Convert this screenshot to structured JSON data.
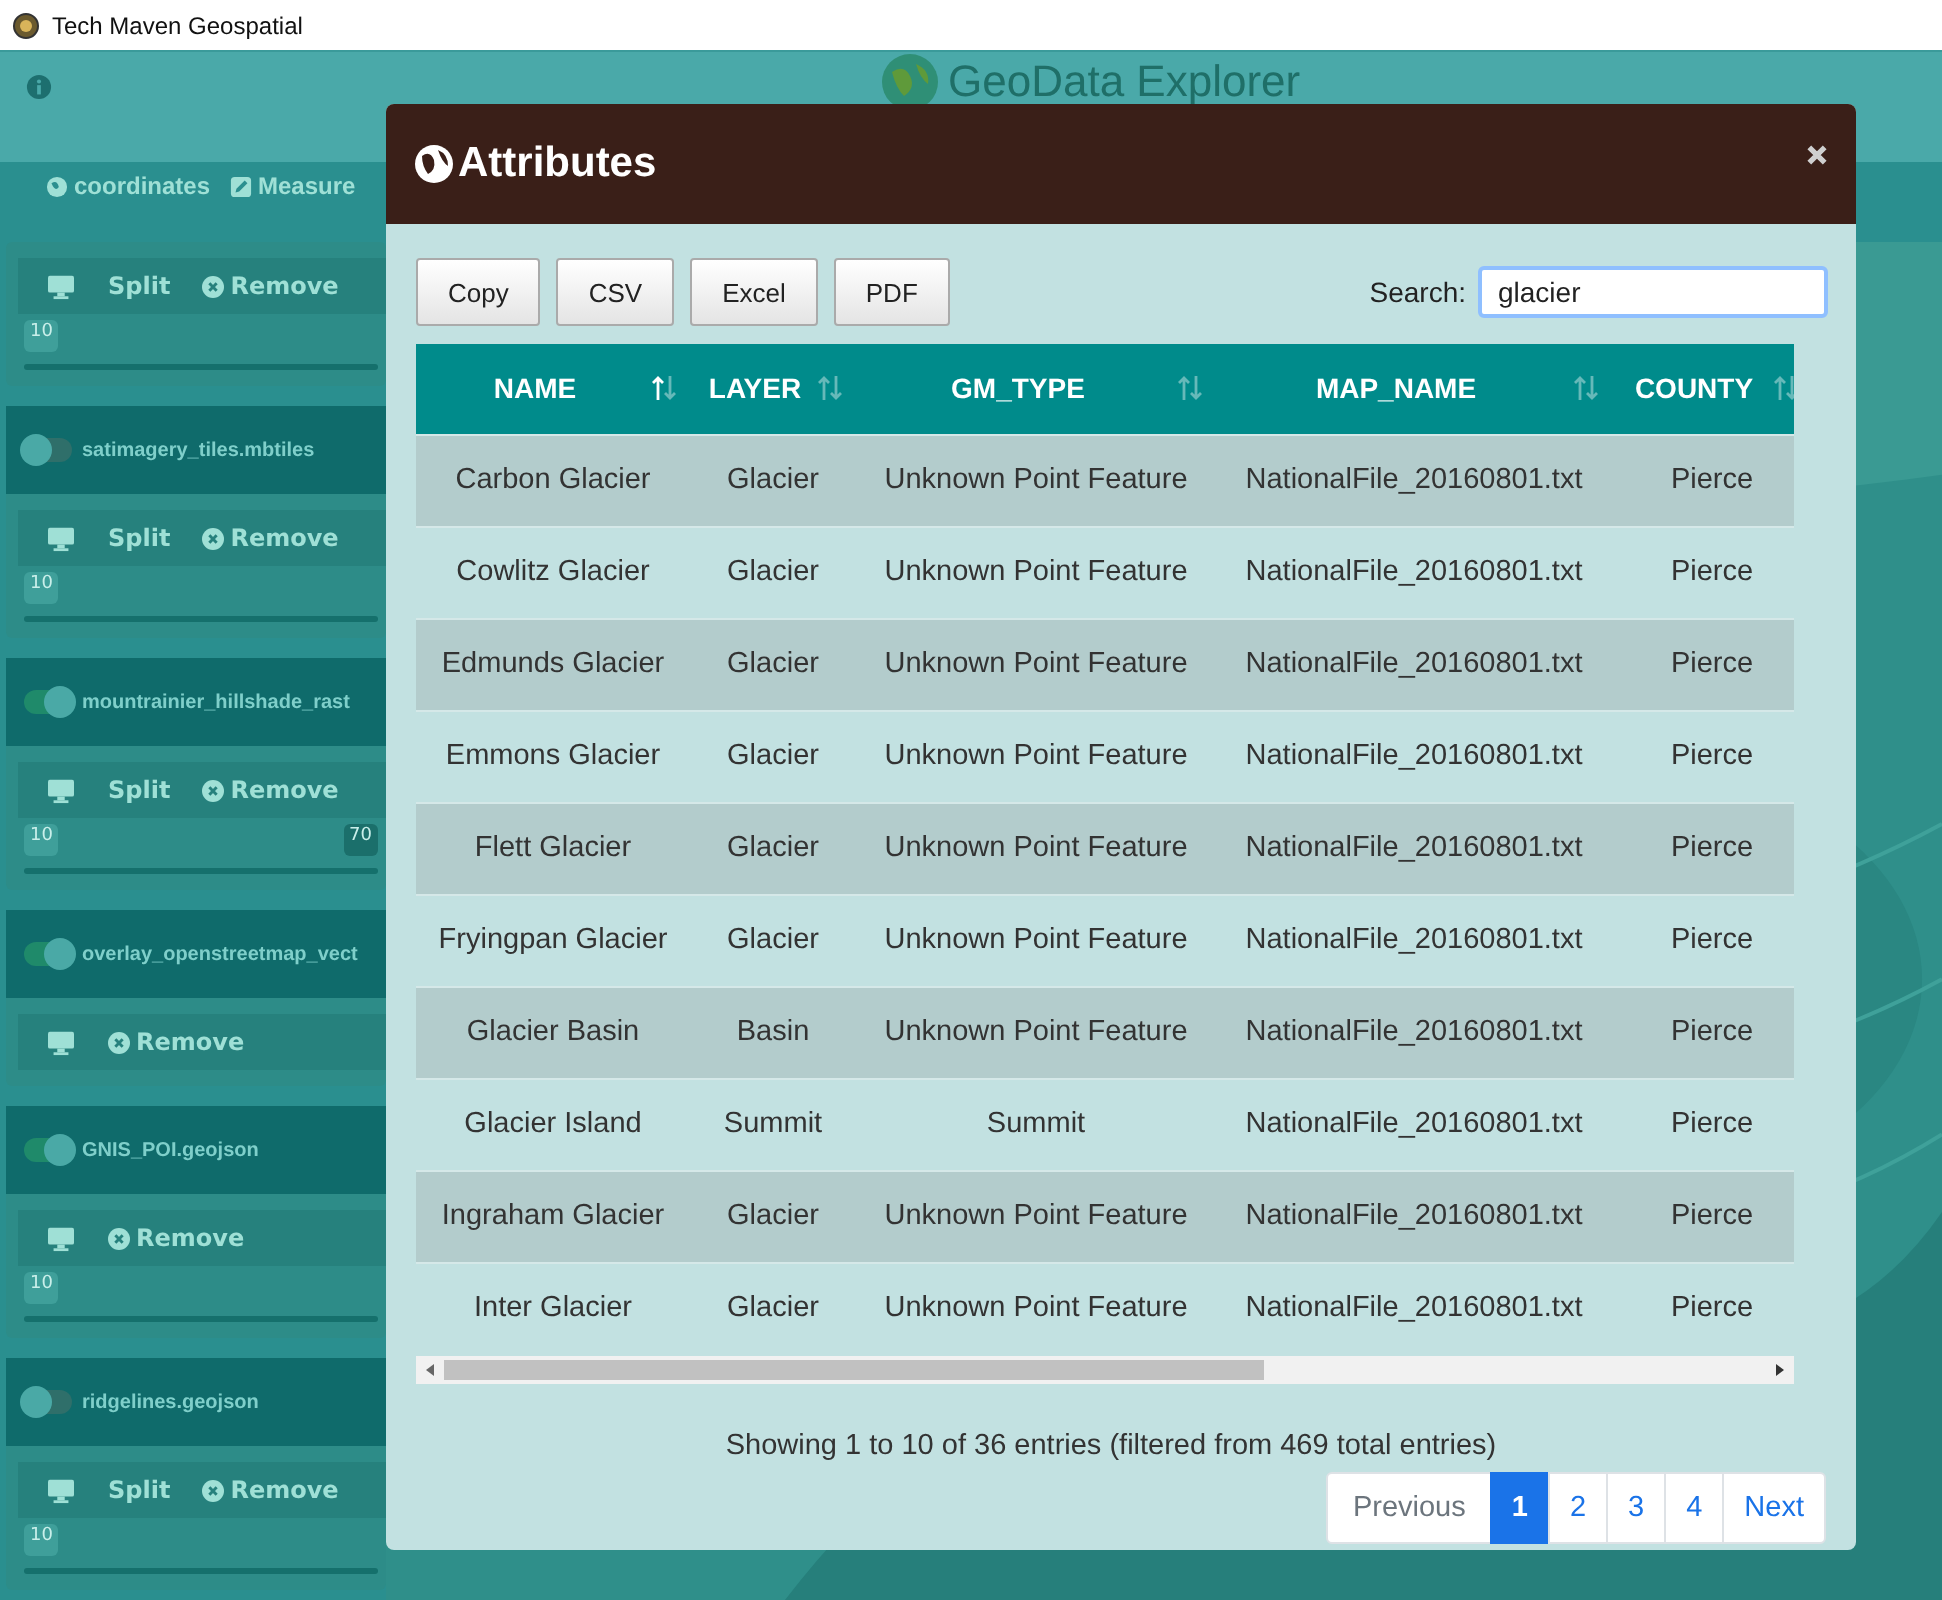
{
  "window": {
    "title": "Tech Maven Geospatial"
  },
  "header": {
    "title": "GeoData Explorer"
  },
  "nav": [
    {
      "label": "coordinates",
      "kind": "globe"
    },
    {
      "label": "Measure",
      "kind": "pencil"
    }
  ],
  "layers": [
    {
      "tools": [
        "Split",
        "Remove"
      ],
      "min": "10"
    },
    {
      "name": "satimagery_tiles.mbtiles",
      "on": false,
      "tools": [
        "Split",
        "Remove"
      ],
      "min": "10"
    },
    {
      "name": "mountrainier_hillshade_rast",
      "on": true,
      "tools": [
        "Split",
        "Remove"
      ],
      "min": "10",
      "value": "70"
    },
    {
      "name": "overlay_openstreetmap_vect",
      "on": true,
      "tools": [
        "Remove"
      ]
    },
    {
      "name": "GNIS_POI.geojson",
      "on": true,
      "tools": [
        "Remove"
      ],
      "min": "10"
    },
    {
      "name": "ridgelines.geojson",
      "on": false,
      "tools": [
        "Split",
        "Remove"
      ],
      "min": "10"
    }
  ],
  "modal": {
    "title": "Attributes",
    "buttons": [
      "Copy",
      "CSV",
      "Excel",
      "PDF"
    ],
    "search": {
      "label": "Search:",
      "value": "glacier"
    },
    "columns": [
      {
        "label": "NAME",
        "sorted": true
      },
      {
        "label": "LAYER",
        "sorted": false
      },
      {
        "label": "GM_TYPE",
        "sorted": false
      },
      {
        "label": "MAP_NAME",
        "sorted": false
      },
      {
        "label": "COUNTY",
        "sorted": false
      }
    ],
    "rows": [
      [
        "Carbon Glacier",
        "Glacier",
        "Unknown Point Feature",
        "NationalFile_20160801.txt",
        "Pierce"
      ],
      [
        "Cowlitz Glacier",
        "Glacier",
        "Unknown Point Feature",
        "NationalFile_20160801.txt",
        "Pierce"
      ],
      [
        "Edmunds Glacier",
        "Glacier",
        "Unknown Point Feature",
        "NationalFile_20160801.txt",
        "Pierce"
      ],
      [
        "Emmons Glacier",
        "Glacier",
        "Unknown Point Feature",
        "NationalFile_20160801.txt",
        "Pierce"
      ],
      [
        "Flett Glacier",
        "Glacier",
        "Unknown Point Feature",
        "NationalFile_20160801.txt",
        "Pierce"
      ],
      [
        "Fryingpan Glacier",
        "Glacier",
        "Unknown Point Feature",
        "NationalFile_20160801.txt",
        "Pierce"
      ],
      [
        "Glacier Basin",
        "Basin",
        "Unknown Point Feature",
        "NationalFile_20160801.txt",
        "Pierce"
      ],
      [
        "Glacier Island",
        "Summit",
        "Summit",
        "NationalFile_20160801.txt",
        "Pierce"
      ],
      [
        "Ingraham Glacier",
        "Glacier",
        "Unknown Point Feature",
        "NationalFile_20160801.txt",
        "Pierce"
      ],
      [
        "Inter Glacier",
        "Glacier",
        "Unknown Point Feature",
        "NationalFile_20160801.txt",
        "Pierce"
      ]
    ],
    "info": "Showing 1 to 10 of 36 entries (filtered from 469 total entries)",
    "pages": [
      {
        "label": "Previous",
        "selected": false
      },
      {
        "label": "1",
        "selected": true
      },
      {
        "label": "2",
        "selected": false
      },
      {
        "label": "3",
        "selected": false
      },
      {
        "label": "4",
        "selected": false
      },
      {
        "label": "Next",
        "selected": false
      }
    ]
  }
}
